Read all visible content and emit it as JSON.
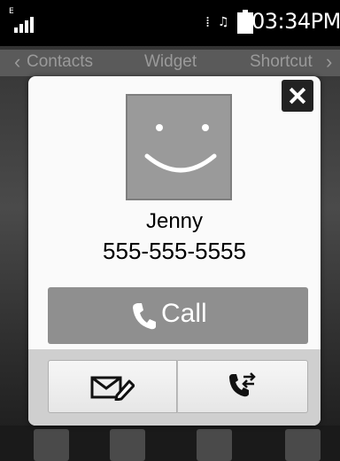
{
  "status_bar": {
    "network_type": "E",
    "clock": "03:34PM"
  },
  "background_tabs": {
    "left": "Contacts",
    "center": "Widget",
    "right": "Shortcut"
  },
  "dialog": {
    "contact": {
      "name": "Jenny",
      "number": "555-555-5555"
    },
    "call_button_label": "Call",
    "icons": {
      "close": "close-icon",
      "avatar": "smiley-avatar-icon",
      "call": "phone-icon",
      "message": "compose-message-icon",
      "transfer": "call-transfer-icon"
    }
  }
}
